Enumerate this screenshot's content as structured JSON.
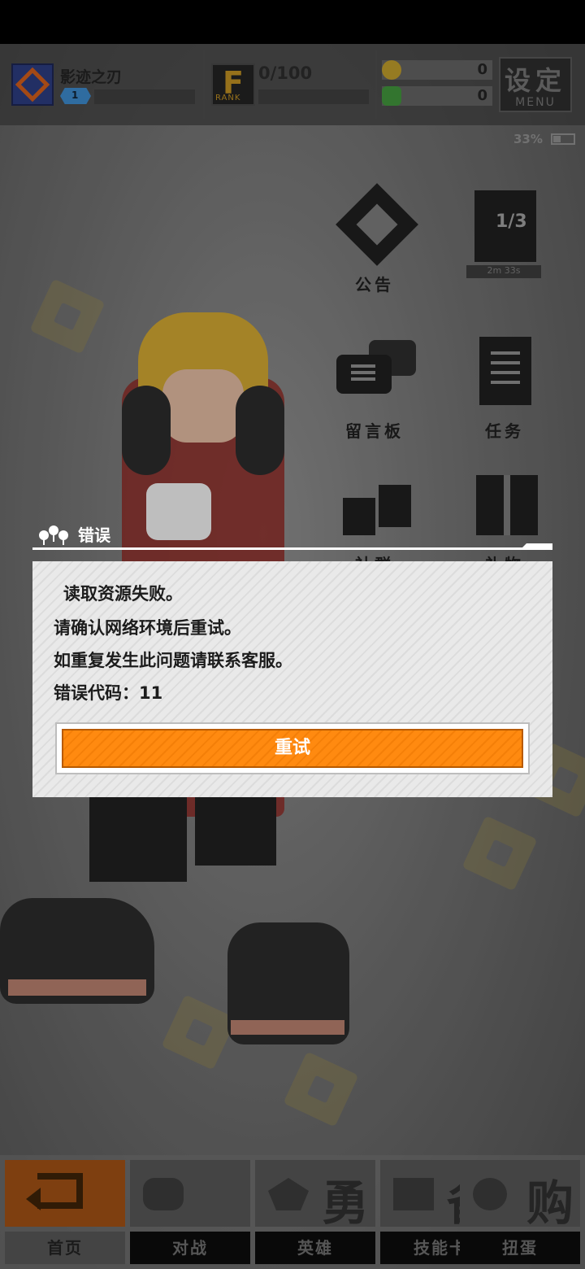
{
  "topbar": {
    "player_name": "影迹之刃",
    "level": "1",
    "rank_letter": "F",
    "rank_label": "RANK",
    "rank_progress": "0/100",
    "coins": "0",
    "gems": "0",
    "menu_cn": "设定",
    "menu_en": "MENU",
    "battery": "33%"
  },
  "features": {
    "notice": "公告",
    "pages": "1/3",
    "timer": "2m 33s",
    "board": "留言板",
    "tasks": "任务",
    "club": "社群",
    "gift": "礼物"
  },
  "dialog": {
    "title": "错误",
    "line1": "读取资源失败。",
    "line2": "请确认网络环境后重试。",
    "line3": "如重复发生此问题请联系客服。",
    "line4": "错误代码：11",
    "retry": "重试"
  },
  "nav": {
    "home": "首页",
    "battle": "对战",
    "battle_big": "",
    "hero": "英雄",
    "hero_big": "勇",
    "skill": "技能卡",
    "skill_big": "备",
    "gacha": "扭蛋",
    "gacha_big": "购"
  },
  "colors": {
    "accent": "#ff8a10",
    "dialog_bg": "#e9e9e9",
    "home_active": "#9a4e14"
  }
}
